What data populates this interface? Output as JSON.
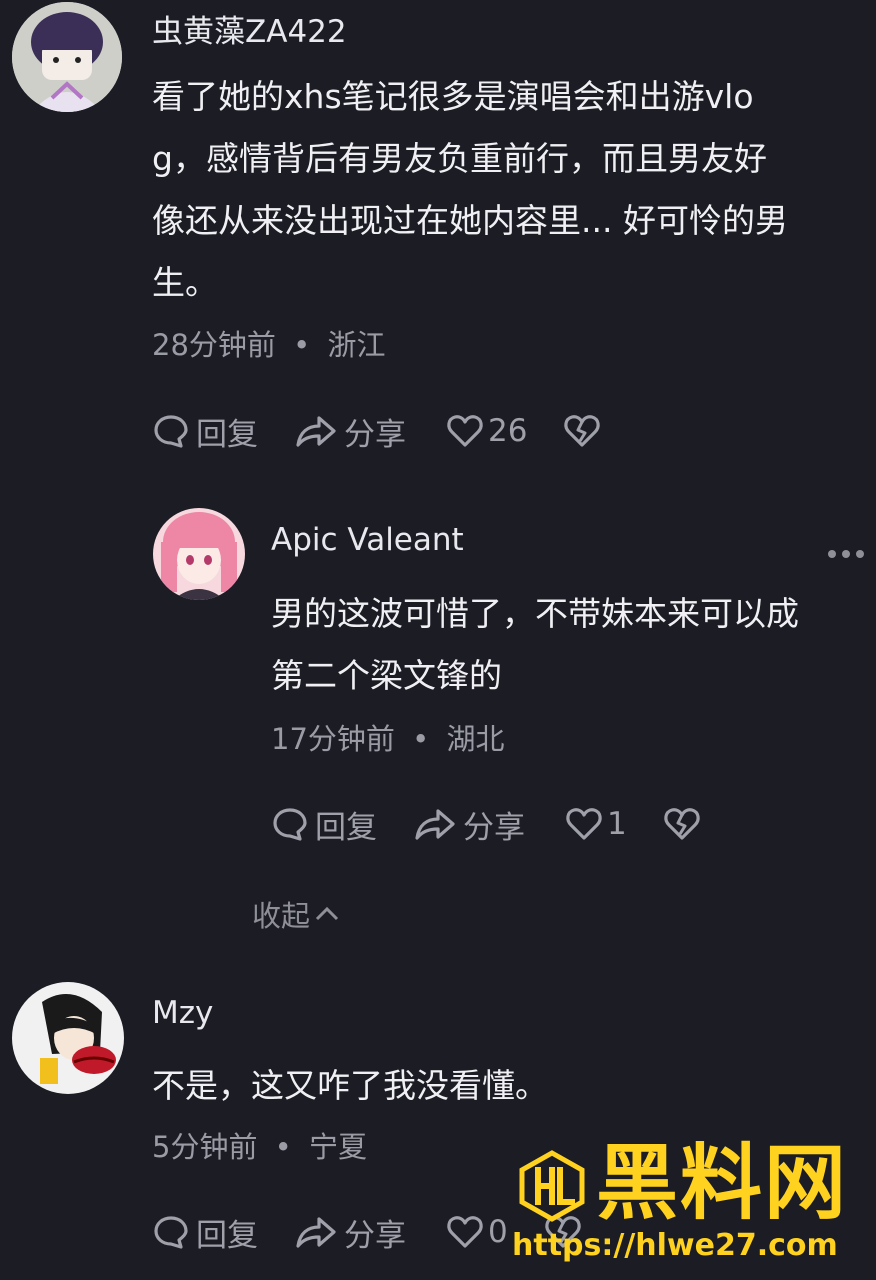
{
  "comments": [
    {
      "user": "虫黄藻ZA422",
      "lines": [
        "看了她的xhs笔记很多是演唱会和出游vlo",
        "g，感情背后有男友负重前行，而且男友好",
        "像还从来没出现过在她内容里... 好可怜的男",
        "生。"
      ],
      "time": "28分钟前",
      "location": "浙江",
      "reply_label": "回复",
      "share_label": "分享",
      "likes": "26"
    },
    {
      "user": "Apic Valeant",
      "lines": [
        "男的这波可惜了，不带妹本来可以成",
        "第二个梁文锋的"
      ],
      "time": "17分钟前",
      "location": "湖北",
      "reply_label": "回复",
      "share_label": "分享",
      "likes": "1"
    },
    {
      "user": "Mzy",
      "lines": [
        "不是，这又咋了我没看懂。"
      ],
      "time": "5分钟前",
      "location": "宁夏",
      "reply_label": "回复",
      "share_label": "分享",
      "likes": "0"
    }
  ],
  "collapse_label": "收起",
  "meta_separator": "•",
  "watermark": {
    "brand": "黑料网",
    "url": "https://hlwe27.com",
    "color": "#ffd21f"
  }
}
